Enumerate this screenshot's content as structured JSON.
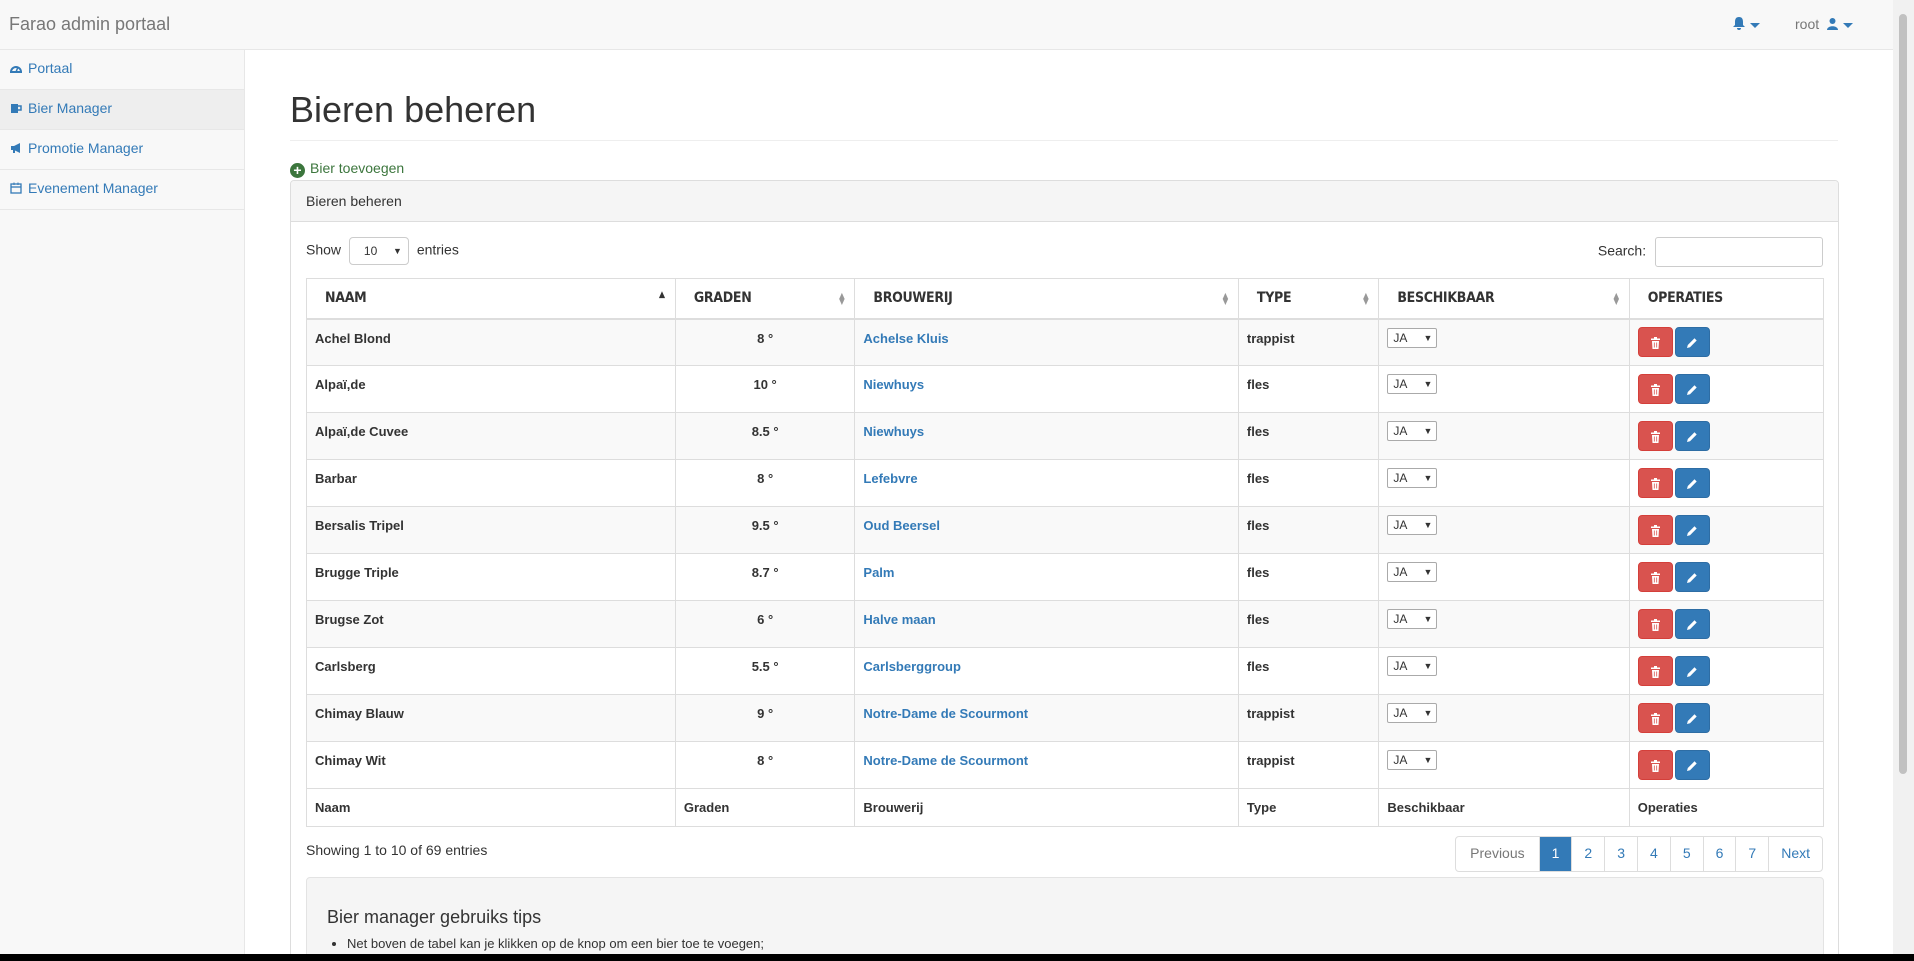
{
  "app": {
    "brand": "Farao admin portaal",
    "user": "root"
  },
  "sidebar": {
    "items": [
      {
        "label": "Portaal",
        "icon": "dashboard-icon"
      },
      {
        "label": "Bier Manager",
        "icon": "beer-icon"
      },
      {
        "label": "Promotie Manager",
        "icon": "bullhorn-icon"
      },
      {
        "label": "Evenement Manager",
        "icon": "calendar-icon"
      }
    ]
  },
  "page": {
    "title": "Bieren beheren",
    "add_label": "Bier toevoegen",
    "panel_heading": "Bieren beheren"
  },
  "controls": {
    "show_label": "Show",
    "entries_value": "10",
    "entries_label": "entries",
    "search_label": "Search:"
  },
  "table": {
    "headers": [
      "NAAM",
      "GRADEN",
      "BROUWERIJ",
      "TYPE",
      "BESCHIKBAAR",
      "OPERATIES"
    ],
    "footers": [
      "Naam",
      "Graden",
      "Brouwerij",
      "Type",
      "Beschikbaar",
      "Operaties"
    ],
    "rows": [
      {
        "naam": "Achel Blond",
        "graden": "8 °",
        "brouwerij": "Achelse Kluis",
        "type": "trappist",
        "beschikbaar": "JA"
      },
      {
        "naam": "Alpaï,de",
        "graden": "10 °",
        "brouwerij": "Niewhuys",
        "type": "fles",
        "beschikbaar": "JA"
      },
      {
        "naam": "Alpaï,de Cuvee",
        "graden": "8.5 °",
        "brouwerij": "Niewhuys",
        "type": "fles",
        "beschikbaar": "JA"
      },
      {
        "naam": "Barbar",
        "graden": "8 °",
        "brouwerij": "Lefebvre",
        "type": "fles",
        "beschikbaar": "JA"
      },
      {
        "naam": "Bersalis Tripel",
        "graden": "9.5 °",
        "brouwerij": "Oud Beersel",
        "type": "fles",
        "beschikbaar": "JA"
      },
      {
        "naam": "Brugge Triple",
        "graden": "8.7 °",
        "brouwerij": "Palm",
        "type": "fles",
        "beschikbaar": "JA"
      },
      {
        "naam": "Brugse Zot",
        "graden": "6 °",
        "brouwerij": "Halve maan",
        "type": "fles",
        "beschikbaar": "JA"
      },
      {
        "naam": "Carlsberg",
        "graden": "5.5 °",
        "brouwerij": "Carlsberggroup",
        "type": "fles",
        "beschikbaar": "JA"
      },
      {
        "naam": "Chimay Blauw",
        "graden": "9 °",
        "brouwerij": "Notre-Dame de Scourmont",
        "type": "trappist",
        "beschikbaar": "JA"
      },
      {
        "naam": "Chimay Wit",
        "graden": "8 °",
        "brouwerij": "Notre-Dame de Scourmont",
        "type": "trappist",
        "beschikbaar": "JA"
      }
    ]
  },
  "pagination": {
    "info": "Showing 1 to 10 of 69 entries",
    "previous": "Previous",
    "next": "Next",
    "pages": [
      "1",
      "2",
      "3",
      "4",
      "5",
      "6",
      "7"
    ],
    "current": "1"
  },
  "tips": {
    "title": "Bier manager gebruiks tips",
    "items": [
      "Net boven de tabel kan je klikken op de knop om een bier toe te voegen;"
    ]
  },
  "colors": {
    "primary": "#337ab7",
    "danger": "#d9534f",
    "success": "#3c763d"
  }
}
